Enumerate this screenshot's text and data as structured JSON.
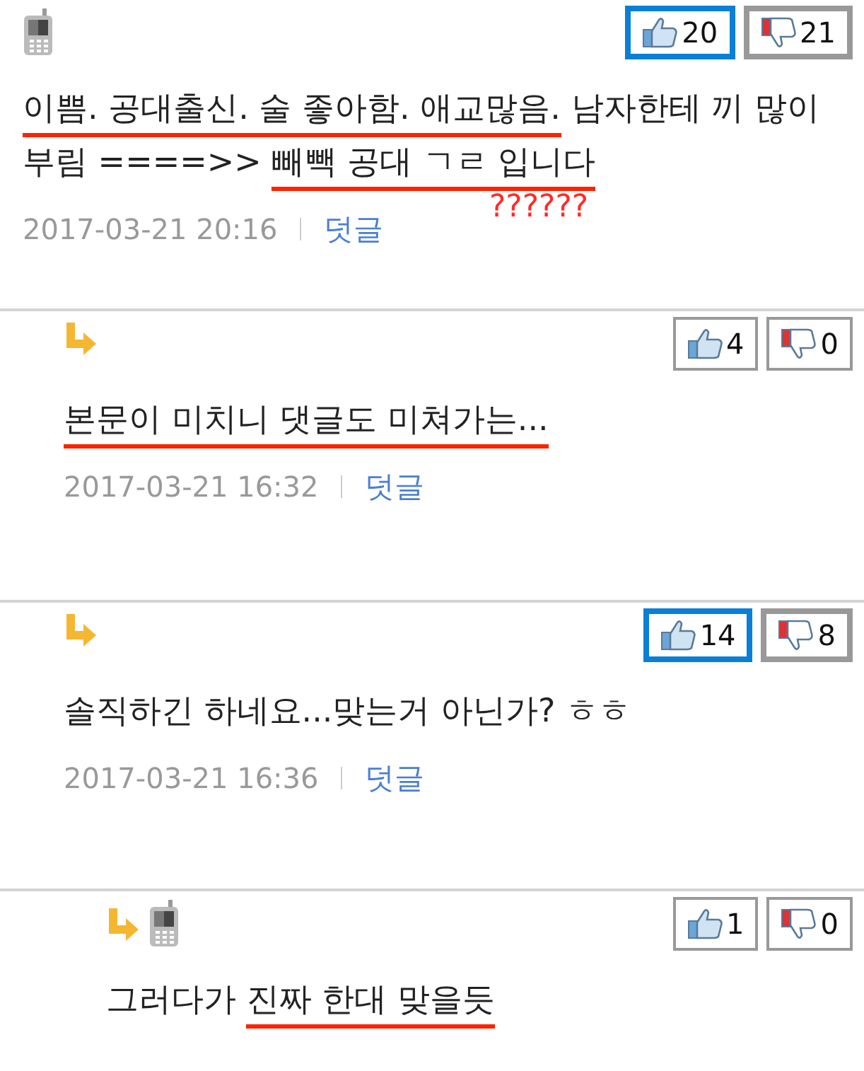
{
  "comments": [
    {
      "device_icon": true,
      "body": [
        {
          "text": "이쁨. 공대출신. 술 좋아함. 애교많음.",
          "underlined": true
        },
        {
          "text": " 남자한테 끼 많이부림 ====>> ",
          "underlined": false
        },
        {
          "text": "빼빽 공대 ㄱㄹ 입니다",
          "underlined": true
        }
      ],
      "date": "2017-03-21 20:16",
      "reply_link": "덧글",
      "note": "??????",
      "votes": [
        {
          "kind": "up",
          "count": "20",
          "highlighted": true
        },
        {
          "kind": "down",
          "count": "21",
          "highlighted": true
        }
      ],
      "children": [
        {
          "device_icon": false,
          "body": [
            {
              "text": "본문이 미치니 댓글도 미쳐가는...",
              "underlined": true
            }
          ],
          "date": "2017-03-21 16:32",
          "reply_link": "덧글",
          "votes": [
            {
              "kind": "up",
              "count": "4",
              "highlighted": false
            },
            {
              "kind": "down",
              "count": "0",
              "highlighted": false
            }
          ]
        },
        {
          "device_icon": false,
          "body": [
            {
              "text": "솔직하긴 하네요...맞는거 아닌가? ㅎㅎ",
              "underlined": false
            }
          ],
          "date": "2017-03-21 16:36",
          "reply_link": "덧글",
          "votes": [
            {
              "kind": "up",
              "count": "14",
              "highlighted": true
            },
            {
              "kind": "down",
              "count": "8",
              "highlighted": true
            }
          ],
          "children": [
            {
              "device_icon": true,
              "body": [
                {
                  "text": "그러다가 ",
                  "underlined": false
                },
                {
                  "text": "진짜 한대 맞을듯",
                  "underlined": true
                }
              ],
              "votes": [
                {
                  "kind": "up",
                  "count": "1",
                  "highlighted": false
                },
                {
                  "kind": "down",
                  "count": "0",
                  "highlighted": false
                }
              ]
            }
          ]
        }
      ]
    }
  ]
}
